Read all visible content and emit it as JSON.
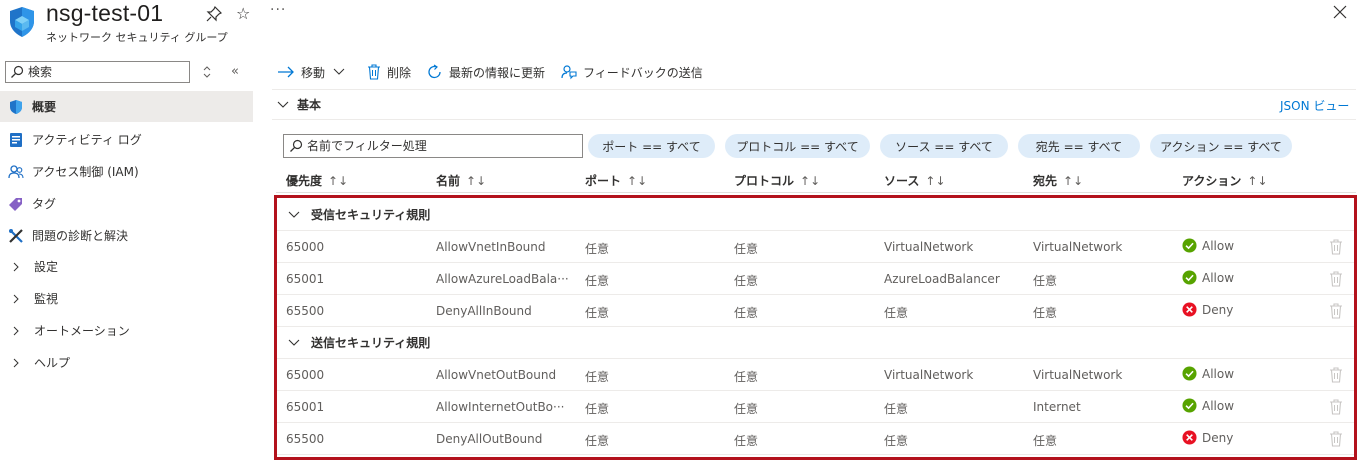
{
  "header": {
    "title": "nsg-test-01",
    "subtitle": "ネットワーク セキュリティ グループ",
    "more_label": "···"
  },
  "sidebar": {
    "search_placeholder": "検索",
    "collapse_label": "«",
    "items": [
      {
        "label": "概要",
        "icon": "shield-icon",
        "active": true
      },
      {
        "label": "アクティビティ ログ",
        "icon": "log-icon"
      },
      {
        "label": "アクセス制御 (IAM)",
        "icon": "people-icon"
      },
      {
        "label": "タグ",
        "icon": "tag-icon"
      },
      {
        "label": "問題の診断と解決",
        "icon": "wrench-icon"
      },
      {
        "label": "設定",
        "icon": "chevron-right-icon"
      },
      {
        "label": "監視",
        "icon": "chevron-right-icon"
      },
      {
        "label": "オートメーション",
        "icon": "chevron-right-icon"
      },
      {
        "label": "ヘルプ",
        "icon": "chevron-right-icon"
      }
    ]
  },
  "toolbar": {
    "move_label": "移動",
    "delete_label": "削除",
    "refresh_label": "最新の情報に更新",
    "feedback_label": "フィードバックの送信"
  },
  "essentials": {
    "label": "基本",
    "json_view_label": "JSON ビュー"
  },
  "filter": {
    "placeholder": "名前でフィルター処理",
    "pills": [
      "ポート == すべて",
      "プロトコル == すべて",
      "ソース == すべて",
      "宛先 == すべて",
      "アクション == すべて"
    ]
  },
  "table": {
    "columns": [
      "優先度",
      "名前",
      "ポート",
      "プロトコル",
      "ソース",
      "宛先",
      "アクション"
    ],
    "sort_glyph_single": "↑↓",
    "groups": [
      {
        "label": "受信セキュリティ規則",
        "rows": [
          {
            "priority": "65000",
            "name": "AllowVnetInBound",
            "port": "任意",
            "protocol": "任意",
            "source": "VirtualNetwork",
            "destination": "VirtualNetwork",
            "action": "Allow"
          },
          {
            "priority": "65001",
            "name": "AllowAzureLoadBala···",
            "port": "任意",
            "protocol": "任意",
            "source": "AzureLoadBalancer",
            "destination": "任意",
            "action": "Allow"
          },
          {
            "priority": "65500",
            "name": "DenyAllInBound",
            "port": "任意",
            "protocol": "任意",
            "source": "任意",
            "destination": "任意",
            "action": "Deny"
          }
        ]
      },
      {
        "label": "送信セキュリティ規則",
        "rows": [
          {
            "priority": "65000",
            "name": "AllowVnetOutBound",
            "port": "任意",
            "protocol": "任意",
            "source": "VirtualNetwork",
            "destination": "VirtualNetwork",
            "action": "Allow"
          },
          {
            "priority": "65001",
            "name": "AllowInternetOutBo···",
            "port": "任意",
            "protocol": "任意",
            "source": "任意",
            "destination": "Internet",
            "action": "Allow"
          },
          {
            "priority": "65500",
            "name": "DenyAllOutBound",
            "port": "任意",
            "protocol": "任意",
            "source": "任意",
            "destination": "任意",
            "action": "Deny"
          }
        ]
      }
    ]
  },
  "colors": {
    "accent": "#0078d4",
    "allow": "#57a300",
    "deny": "#e81123",
    "highlight_border": "#b3121c",
    "pill_bg": "#deecf9"
  }
}
